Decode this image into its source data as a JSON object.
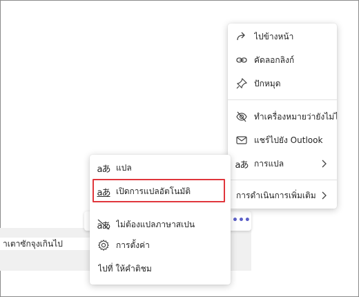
{
  "chat": {
    "message_text": "าเตาซักจุงเกินไป",
    "more_options_glyph": "•••"
  },
  "main_menu": {
    "items": [
      {
        "label": "ไปข้างหน้า",
        "icon": "forward-icon"
      },
      {
        "label": "คัดลอกลิงก์",
        "icon": "link-icon"
      },
      {
        "label": "ปักหมุด",
        "icon": "pin-icon"
      },
      {
        "label": "ทำเครื่องหมายว่ายังไม่ได้อ่าน",
        "icon": "eye-off-icon"
      },
      {
        "label": "แชร์ไปยัง Outlook",
        "icon": "mail-icon"
      },
      {
        "label": "การแปล",
        "icon": "translate-icon",
        "has_submenu": true
      },
      {
        "label": "การดำเนินการเพิ่มเติม",
        "has_submenu": true
      }
    ]
  },
  "sub_menu": {
    "items": [
      {
        "label": "แปล",
        "icon": "translate-icon"
      },
      {
        "label": "เปิดการแปลอัตโนมัติ",
        "icon": "auto-translate-icon",
        "highlighted": true
      },
      {
        "label": "ไม่ต้องแปลภาษาสเปน",
        "icon": "no-translate-icon"
      },
      {
        "label": "การตั้งค่า",
        "icon": "settings-icon"
      },
      {
        "label": "ไปที่ ให้คำติชม"
      }
    ]
  },
  "colors": {
    "accent": "#5b5fc7",
    "highlight_border": "#e0353b",
    "text": "#242424"
  }
}
